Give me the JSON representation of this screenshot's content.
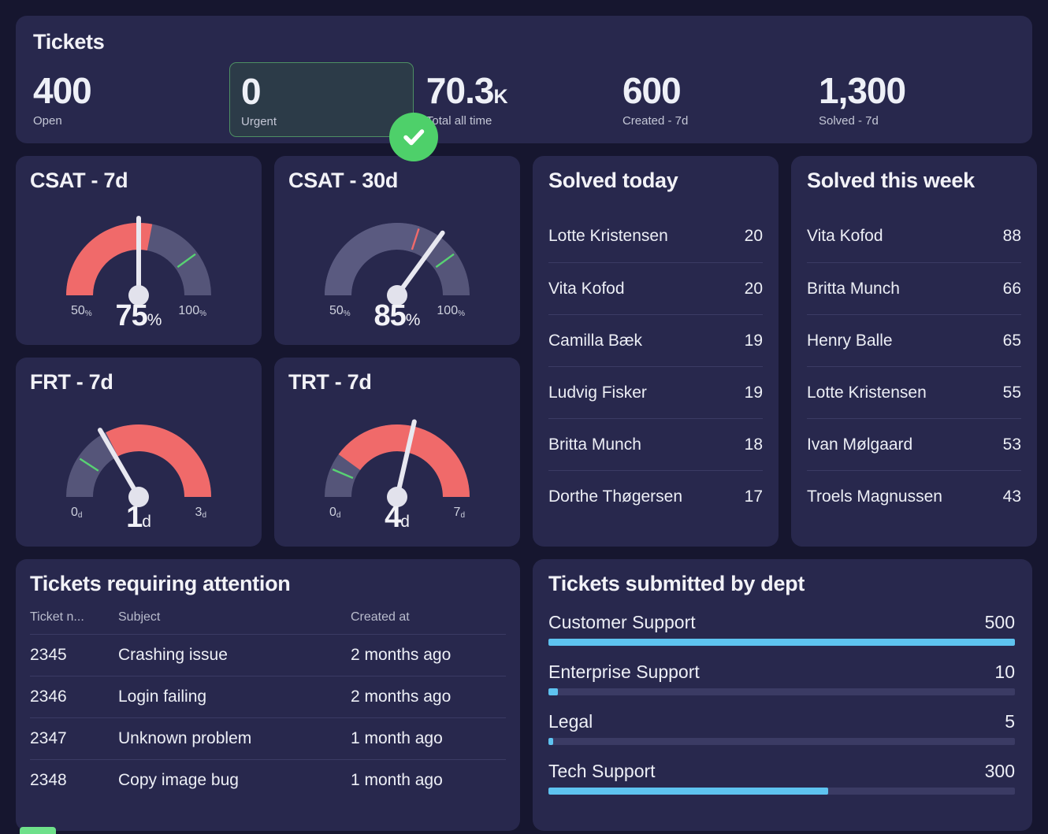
{
  "tickets_header": {
    "title": "Tickets",
    "kpis": [
      {
        "value": "400",
        "suffix": "",
        "label": "Open",
        "highlight": false
      },
      {
        "value": "0",
        "suffix": "",
        "label": "Urgent",
        "highlight": true,
        "accent": "#4e8f63"
      },
      {
        "value": "70.3",
        "suffix": "K",
        "label": "Total all time",
        "highlight": false
      },
      {
        "value": "600",
        "suffix": "",
        "label": "Created - 7d",
        "highlight": false
      },
      {
        "value": "1,300",
        "suffix": "",
        "label": "Solved - 7d",
        "highlight": false
      }
    ],
    "status_badge_icon": "check-circle-icon",
    "status_badge_color": "#4ed06a"
  },
  "chart_data": [
    {
      "type": "gauge",
      "title": "CSAT - 7d",
      "value": 75,
      "display_value": "75",
      "unit": "%",
      "min": 50,
      "max": 100,
      "min_label": "50",
      "max_label": "100",
      "axis_unit": "%",
      "red_zone": [
        50,
        78
      ],
      "thresholds": [
        {
          "value": 90,
          "color": "#58d273"
        }
      ],
      "colors": {
        "red": "#f06a6a",
        "track": "#555579",
        "needle": "#e8e8f0"
      }
    },
    {
      "type": "gauge",
      "title": "CSAT - 30d",
      "value": 85,
      "display_value": "85",
      "unit": "%",
      "min": 50,
      "max": 100,
      "min_label": "50",
      "max_label": "100",
      "axis_unit": "%",
      "red_zone": null,
      "thresholds": [
        {
          "value": 80,
          "color": "#f06a6a"
        },
        {
          "value": 90,
          "color": "#58d273"
        }
      ],
      "colors": {
        "red": "#f06a6a",
        "track": "#555579",
        "track_alt": "#4b4b70",
        "needle": "#e8e8f0"
      }
    },
    {
      "type": "gauge",
      "title": "FRT - 7d",
      "value": 1,
      "display_value": "1",
      "unit": "d",
      "min": 0,
      "max": 3,
      "min_label": "0",
      "max_label": "3",
      "axis_unit": "d",
      "red_zone": [
        1.05,
        3
      ],
      "thresholds": [
        {
          "value": 0.55,
          "color": "#58d273"
        }
      ],
      "colors": {
        "red": "#f06a6a",
        "track": "#555579",
        "needle": "#e8e8f0"
      }
    },
    {
      "type": "gauge",
      "title": "TRT - 7d",
      "value": 4,
      "display_value": "4",
      "unit": "d",
      "min": 0,
      "max": 7,
      "min_label": "0",
      "max_label": "7",
      "axis_unit": "d",
      "red_zone": [
        1.4,
        7
      ],
      "thresholds": [
        {
          "value": 0.9,
          "color": "#58d273"
        }
      ],
      "colors": {
        "red": "#f06a6a",
        "track": "#555579",
        "needle": "#e8e8f0"
      }
    },
    {
      "type": "bar",
      "orientation": "horizontal",
      "title": "Tickets submitted by dept",
      "categories": [
        "Customer Support",
        "Enterprise Support",
        "Legal",
        "Tech Support"
      ],
      "values": [
        500,
        10,
        5,
        300
      ],
      "max_scale": 500,
      "bar_color": "#5ec3f0",
      "track_color": "#3b3b64",
      "xlabel": "",
      "ylabel": ""
    }
  ],
  "solved_today": {
    "title": "Solved today",
    "rows": [
      {
        "name": "Lotte Kristensen",
        "count": "20"
      },
      {
        "name": "Vita Kofod",
        "count": "20"
      },
      {
        "name": "Camilla Bæk",
        "count": "19"
      },
      {
        "name": "Ludvig Fisker",
        "count": "19"
      },
      {
        "name": "Britta Munch",
        "count": "18"
      },
      {
        "name": "Dorthe Thøgersen",
        "count": "17"
      }
    ]
  },
  "solved_this_week": {
    "title": "Solved this week",
    "rows": [
      {
        "name": "Vita Kofod",
        "count": "88"
      },
      {
        "name": "Britta Munch",
        "count": "66"
      },
      {
        "name": "Henry Balle",
        "count": "65"
      },
      {
        "name": "Lotte Kristensen",
        "count": "55"
      },
      {
        "name": "Ivan Mølgaard",
        "count": "53"
      },
      {
        "name": "Troels Magnussen",
        "count": "43"
      }
    ]
  },
  "attention_table": {
    "title": "Tickets requiring attention",
    "columns": [
      "Ticket n...",
      "Subject",
      "Created at"
    ],
    "rows": [
      {
        "id": "2345",
        "subject": "Crashing issue",
        "created": "2 months ago"
      },
      {
        "id": "2346",
        "subject": "Login failing",
        "created": "2 months ago"
      },
      {
        "id": "2347",
        "subject": "Unknown problem",
        "created": "1 month ago"
      },
      {
        "id": "2348",
        "subject": "Copy image bug",
        "created": "1 month ago"
      }
    ]
  },
  "dept_chart": {
    "title": "Tickets submitted by dept"
  }
}
